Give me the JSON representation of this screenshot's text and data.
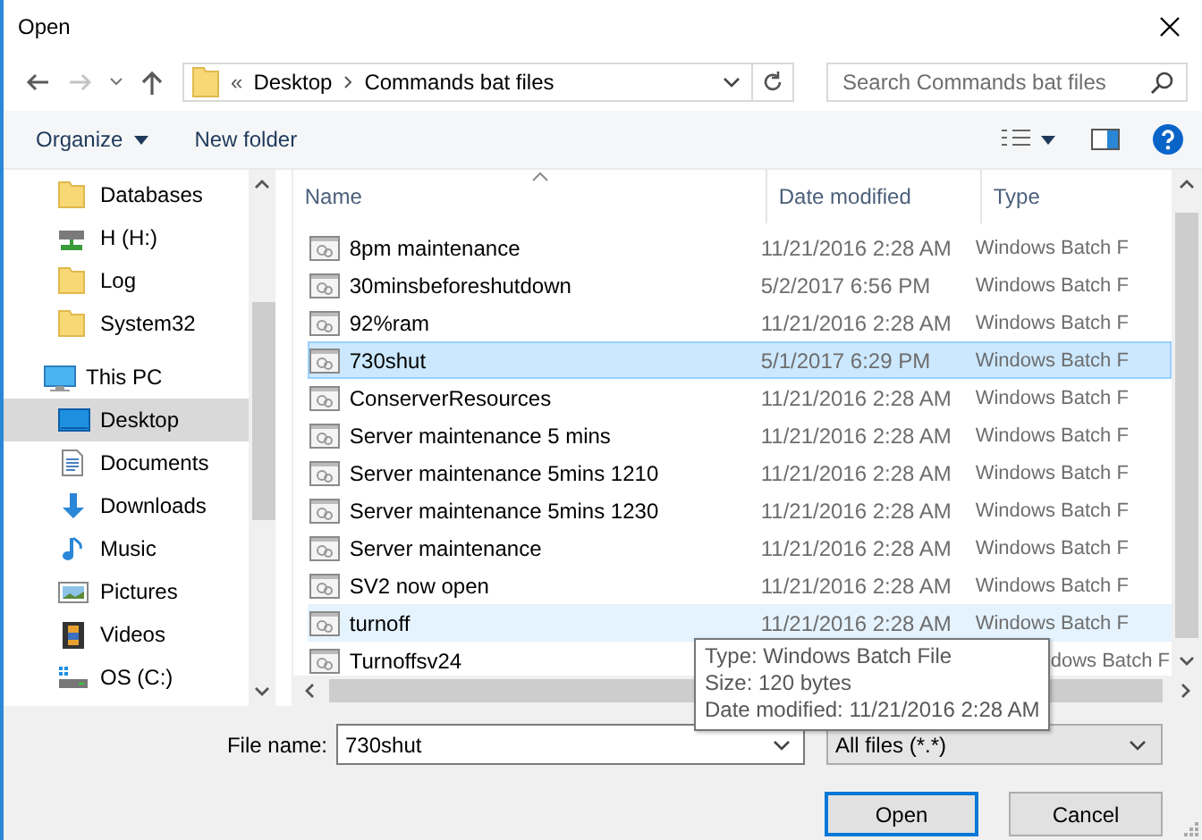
{
  "window": {
    "title": "Open"
  },
  "nav": {
    "back": {
      "disabled": false
    },
    "forward": {
      "disabled": true
    }
  },
  "breadcrumb": {
    "overflow": "«",
    "parts": [
      "Desktop",
      "Commands bat files"
    ]
  },
  "search": {
    "placeholder": "Search Commands bat files"
  },
  "toolbar": {
    "buttons": [
      {
        "label": "Organize",
        "dropdown": true
      },
      {
        "label": "New folder",
        "dropdown": false
      }
    ]
  },
  "sidebar": {
    "items": [
      {
        "children": [
          {
            "label": "Databases",
            "kind": "folder",
            "selected": false
          },
          {
            "label": "H (H:)",
            "kind": "network-drive",
            "selected": false
          },
          {
            "label": "Log",
            "kind": "folder",
            "selected": false
          },
          {
            "label": "System32",
            "kind": "folder",
            "selected": false
          }
        ]
      },
      {
        "label": "This PC",
        "kind": "computer",
        "selected": false,
        "children": [
          {
            "label": "Desktop",
            "kind": "desktop",
            "selected": true
          },
          {
            "label": "Documents",
            "kind": "documents",
            "selected": false
          },
          {
            "label": "Downloads",
            "kind": "downloads",
            "selected": false
          },
          {
            "label": "Music",
            "kind": "music",
            "selected": false
          },
          {
            "label": "Pictures",
            "kind": "pictures",
            "selected": false
          },
          {
            "label": "Videos",
            "kind": "videos",
            "selected": false
          },
          {
            "label": "OS (C:)",
            "kind": "os-drive",
            "selected": false
          }
        ]
      }
    ]
  },
  "table": {
    "columns": [
      {
        "label": "Name",
        "sorted": true
      },
      {
        "label": "Date modified",
        "sorted": false
      },
      {
        "label": "Type",
        "sorted": false
      }
    ],
    "rows": [
      {
        "name": "8pm maintenance",
        "date": "11/21/2016 2:28 AM",
        "type": "Windows Batch F",
        "selected": false,
        "hovered": false
      },
      {
        "name": "30minsbeforeshutdown",
        "date": "5/2/2017 6:56 PM",
        "type": "Windows Batch F",
        "selected": false,
        "hovered": false
      },
      {
        "name": "92%ram",
        "date": "11/21/2016 2:28 AM",
        "type": "Windows Batch F",
        "selected": false,
        "hovered": false
      },
      {
        "name": "730shut",
        "date": "5/1/2017 6:29 PM",
        "type": "Windows Batch F",
        "selected": true,
        "hovered": false
      },
      {
        "name": "ConserverResources",
        "date": "11/21/2016 2:28 AM",
        "type": "Windows Batch F",
        "selected": false,
        "hovered": false
      },
      {
        "name": "Server maintenance 5 mins",
        "date": "11/21/2016 2:28 AM",
        "type": "Windows Batch F",
        "selected": false,
        "hovered": false
      },
      {
        "name": "Server maintenance 5mins 1210",
        "date": "11/21/2016 2:28 AM",
        "type": "Windows Batch F",
        "selected": false,
        "hovered": false
      },
      {
        "name": "Server maintenance 5mins 1230",
        "date": "11/21/2016 2:28 AM",
        "type": "Windows Batch F",
        "selected": false,
        "hovered": false
      },
      {
        "name": "Server maintenance",
        "date": "11/21/2016 2:28 AM",
        "type": "Windows Batch F",
        "selected": false,
        "hovered": false
      },
      {
        "name": "SV2 now open",
        "date": "11/21/2016 2:28 AM",
        "type": "Windows Batch F",
        "selected": false,
        "hovered": false
      },
      {
        "name": "turnoff",
        "date": "11/21/2016 2:28 AM",
        "type": "Windows Batch F",
        "selected": false,
        "hovered": true
      },
      {
        "name": "Turnoffsv24",
        "type": "dows Batch F",
        "selected": false,
        "hovered": false
      }
    ]
  },
  "tooltip": {
    "lines": [
      "Type: Windows Batch File",
      "Size: 120 bytes",
      "Date modified: 11/21/2016 2:28 AM"
    ]
  },
  "footer": {
    "file_name_label": "File name:",
    "file_name": "730shut",
    "filter": "All files (*.*)",
    "buttons": [
      {
        "label": "Open",
        "default": true
      },
      {
        "label": "Cancel",
        "default": false
      }
    ]
  }
}
